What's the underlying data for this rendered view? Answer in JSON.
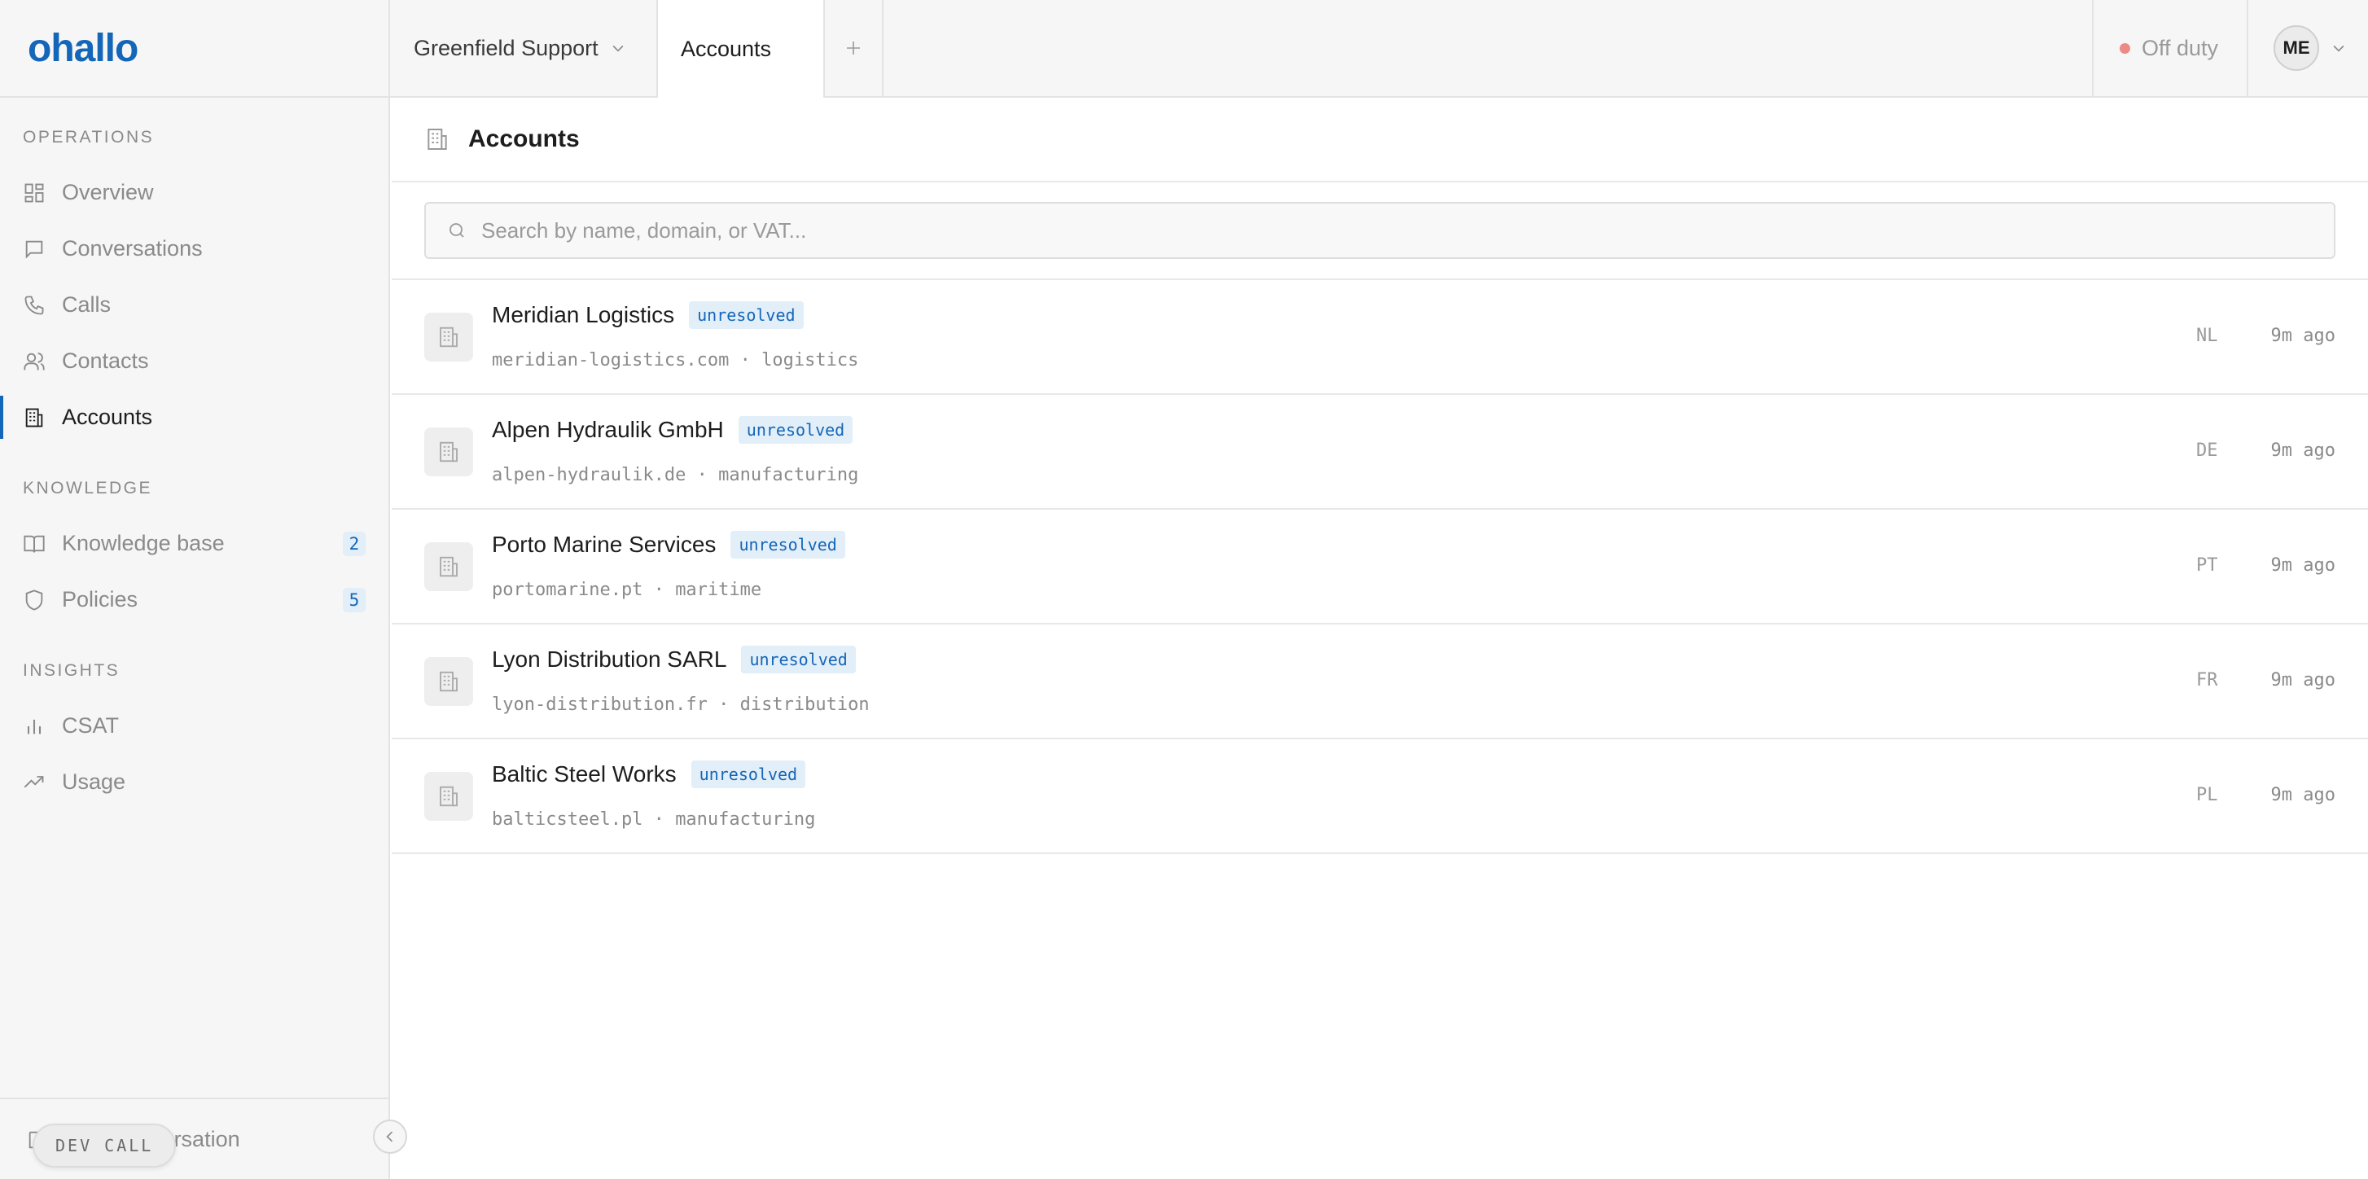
{
  "app": {
    "logo_text": "ohallo",
    "brand_color": "#1466b8"
  },
  "sidebar": {
    "sections": [
      {
        "label": "OPERATIONS",
        "items": [
          {
            "label": "Overview",
            "icon": "grid-icon"
          },
          {
            "label": "Conversations",
            "icon": "chat-icon"
          },
          {
            "label": "Calls",
            "icon": "phone-icon"
          },
          {
            "label": "Contacts",
            "icon": "users-icon"
          },
          {
            "label": "Accounts",
            "icon": "building-icon",
            "active": true
          }
        ]
      },
      {
        "label": "KNOWLEDGE",
        "items": [
          {
            "label": "Knowledge base",
            "icon": "book-icon",
            "count": "2"
          },
          {
            "label": "Policies",
            "icon": "shield-icon",
            "count": "5"
          }
        ]
      },
      {
        "label": "INSIGHTS",
        "items": [
          {
            "label": "CSAT",
            "icon": "bar-chart-icon"
          },
          {
            "label": "Usage",
            "icon": "trend-icon"
          }
        ]
      }
    ],
    "footer": {
      "new_conversation_label": "New conversation",
      "dev_call_label": "DEV CALL"
    }
  },
  "topbar": {
    "workspace": "Greenfield Support",
    "active_tab": "Accounts",
    "status": "Off duty",
    "status_color": "#ee8a85",
    "user_initials": "ME"
  },
  "main": {
    "title": "Accounts",
    "search_placeholder": "Search by name, domain, or VAT...",
    "accounts": [
      {
        "name": "Meridian Logistics",
        "status": "unresolved",
        "domain": "meridian-logistics.com",
        "industry": "logistics",
        "country": "NL",
        "updated": "9m ago"
      },
      {
        "name": "Alpen Hydraulik GmbH",
        "status": "unresolved",
        "domain": "alpen-hydraulik.de",
        "industry": "manufacturing",
        "country": "DE",
        "updated": "9m ago"
      },
      {
        "name": "Porto Marine Services",
        "status": "unresolved",
        "domain": "portomarine.pt",
        "industry": "maritime",
        "country": "PT",
        "updated": "9m ago"
      },
      {
        "name": "Lyon Distribution SARL",
        "status": "unresolved",
        "domain": "lyon-distribution.fr",
        "industry": "distribution",
        "country": "FR",
        "updated": "9m ago"
      },
      {
        "name": "Baltic Steel Works",
        "status": "unresolved",
        "domain": "balticsteel.pl",
        "industry": "manufacturing",
        "country": "PL",
        "updated": "9m ago"
      }
    ]
  }
}
